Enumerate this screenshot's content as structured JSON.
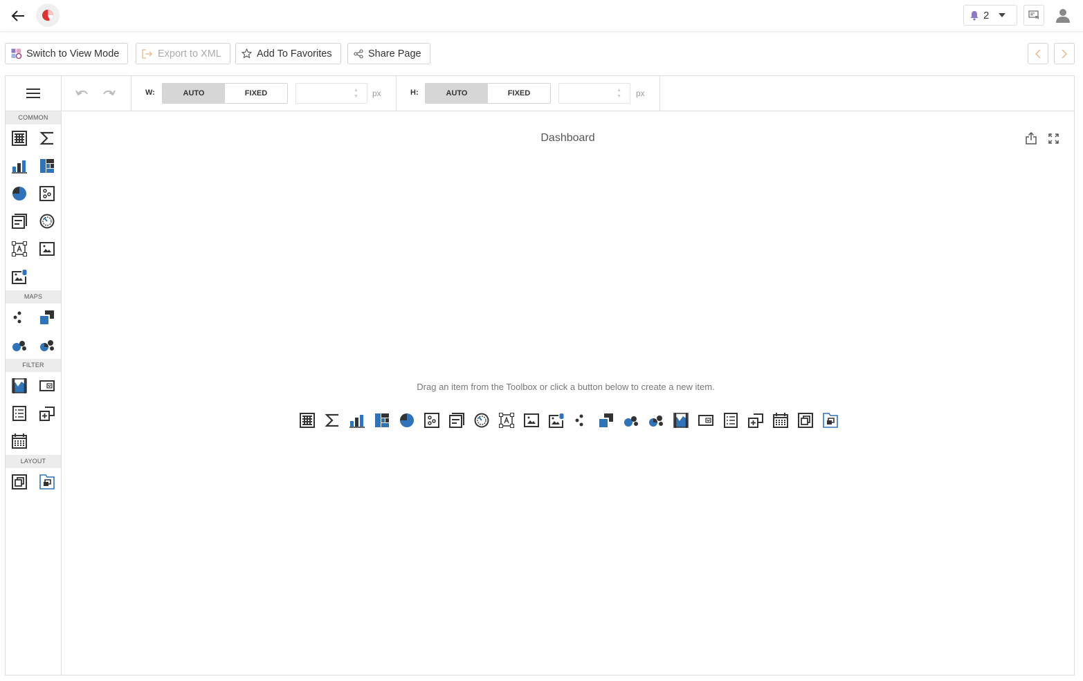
{
  "header": {
    "notifications_count": "2",
    "icons": {
      "back": "arrow-left-icon",
      "logo": "pie-chart-logo",
      "notifications": "bell-icon",
      "messages": "message-icon",
      "user": "user-icon"
    }
  },
  "actions": {
    "switch_view_mode": "Switch to View Mode",
    "export_xml": "Export to XML",
    "add_favorites": "Add To Favorites",
    "share_page": "Share Page"
  },
  "toolbox": {
    "groups": {
      "common": "COMMON",
      "maps": "MAPS",
      "filter": "FILTER",
      "layout": "LAYOUT"
    },
    "common_items": [
      "grid",
      "card",
      "chart",
      "treemap",
      "pie",
      "scatter",
      "cards",
      "gauge",
      "text-box",
      "image",
      "bound-image"
    ],
    "maps_items": [
      "geo-point-map",
      "choropleth-map",
      "bubble-map",
      "pie-map"
    ],
    "filter_items": [
      "range-filter",
      "combo-box",
      "list-box",
      "tree-view",
      "date-filter"
    ],
    "layout_items": [
      "group",
      "tab-container"
    ]
  },
  "sizebar": {
    "width_label": "W:",
    "height_label": "H:",
    "auto_label": "AUTO",
    "fixed_label": "FIXED",
    "width_mode": "AUTO",
    "height_mode": "AUTO",
    "unit": "px"
  },
  "canvas": {
    "title": "Dashboard",
    "hint": "Drag an item from the Toolbox or click a button below to create a new item."
  },
  "colors": {
    "accent_blue": "#2f73b8",
    "icon_dark": "#333333",
    "logo_red": "#e0322f",
    "bell_purple": "#8e79c9"
  }
}
